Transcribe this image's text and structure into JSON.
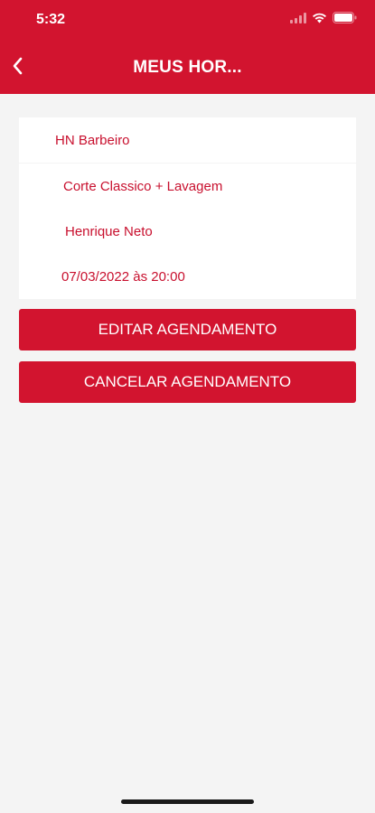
{
  "status_bar": {
    "time": "5:32",
    "icons": [
      "signal-icon",
      "wifi-icon",
      "battery-icon"
    ]
  },
  "header": {
    "title": "MEUS HOR...",
    "back_icon": "chevron-left-icon"
  },
  "appointment": {
    "barbershop": "HN Barbeiro",
    "service": "Corte Classico + Lavagem",
    "barber": "Henrique Neto",
    "datetime": "07/03/2022 às 20:00"
  },
  "actions": {
    "edit_label": "EDITAR AGENDAMENTO",
    "cancel_label": "CANCELAR AGENDAMENTO"
  },
  "colors": {
    "accent": "#d2142f",
    "text_red": "#c8102e",
    "background": "#f4f4f4",
    "card": "#ffffff"
  }
}
